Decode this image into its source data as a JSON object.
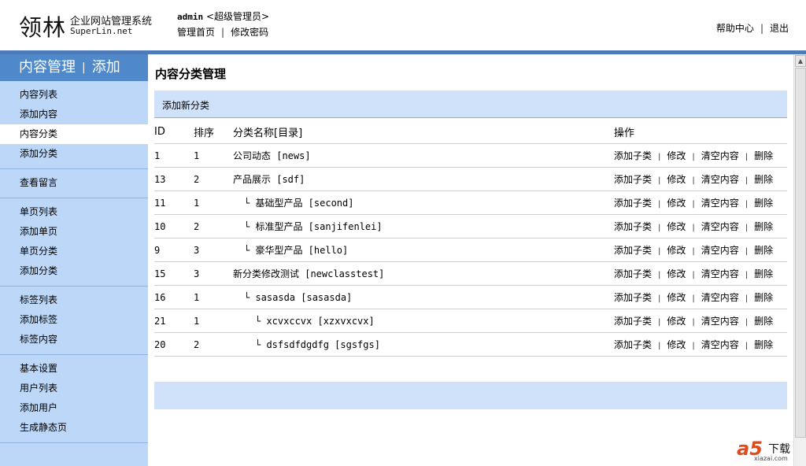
{
  "header": {
    "logo_main": "领林",
    "logo_line1": "企业网站管理系统",
    "logo_line2": "SuperLin.net",
    "username": "admin",
    "role": "<超级管理员>",
    "links": [
      "管理首页",
      "修改密码"
    ],
    "right_links": [
      "帮助中心",
      "退出"
    ],
    "separator": "|"
  },
  "sidebar": {
    "title_left": "内容管理",
    "title_sep": "|",
    "title_right": "添加",
    "groups": [
      [
        "内容列表",
        "添加内容",
        "内容分类",
        "添加分类"
      ],
      [
        "查看留言"
      ],
      [
        "单页列表",
        "添加单页",
        "单页分类",
        "添加分类"
      ],
      [
        "标签列表",
        "添加标签",
        "标签内容"
      ],
      [
        "基本设置",
        "用户列表",
        "添加用户",
        "生成静态页"
      ]
    ],
    "active": "内容分类"
  },
  "main": {
    "title": "内容分类管理",
    "add_label": "添加新分类",
    "columns": [
      "ID",
      "排序",
      "分类名称[目录]",
      "操作"
    ],
    "rows": [
      {
        "id": "1",
        "order": "1",
        "name": "公司动态 [news]"
      },
      {
        "id": "13",
        "order": "2",
        "name": "产品展示 [sdf]"
      },
      {
        "id": "11",
        "order": "1",
        "name": "└ 基础型产品 [second]"
      },
      {
        "id": "10",
        "order": "2",
        "name": "└ 标准型产品 [sanjifenlei]"
      },
      {
        "id": "9",
        "order": "3",
        "name": "└ 豪华型产品 [hello]"
      },
      {
        "id": "15",
        "order": "3",
        "name": "新分类修改测试 [newclasstest]"
      },
      {
        "id": "16",
        "order": "1",
        "name": "└ sasasda [sasasda]"
      },
      {
        "id": "21",
        "order": "1",
        "name": "└ xcvxccvx [xzxvxcvx]"
      },
      {
        "id": "20",
        "order": "2",
        "name": "└ dsfsdfdgdfg [sgsfgs]"
      }
    ],
    "ops": [
      "添加子类",
      "修改",
      "清空内容",
      "删除"
    ],
    "op_sep": "|"
  },
  "watermark": {
    "logo": "a5",
    "text": "下载",
    "url": "xiazai.com"
  },
  "colors": {
    "accent": "#5089c9",
    "sidebar_bg": "#bcd7f7",
    "bar_bg": "#cfe2fa",
    "topbar": "#4d7ab9"
  }
}
